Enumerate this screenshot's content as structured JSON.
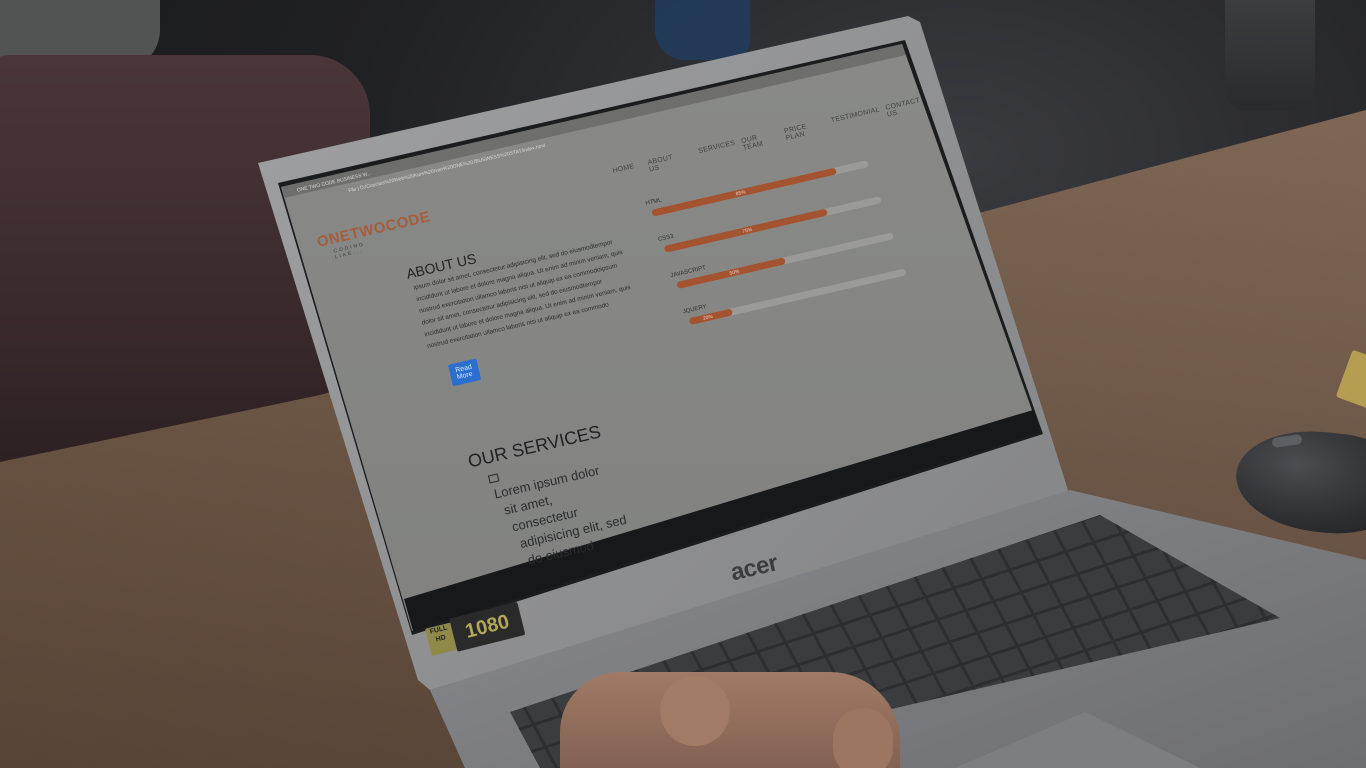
{
  "browser": {
    "tab_title": "ONE TWO CODE BUSINESS W...",
    "address": "File | D:/Courses%20Web%20Kurs%20Ivan%20ONE%20JBUSINESS%20STAT/index.html"
  },
  "site": {
    "logo": "ONETWOCODE",
    "logo_tagline": "CODING LIKE...",
    "nav": [
      "HOME",
      "ABOUT US",
      "SERVICES",
      "OUR TEAM",
      "PRICE PLAN",
      "TESTIMONIAL",
      "CONTACT US"
    ],
    "about_title": "ABOUT US",
    "about_lines": [
      "ipsum dolor sit amet, consectetur adipisicing elit, sed do eiusmodtempor",
      "incididunt ut labore et dolore magna aliqua. Ut enim ad minim veniam, quis",
      "nostrud exercitation ullamco laboris nisi ut aliquip ex ea commodoipsum",
      "dolor sit amet, consectetur adipisicing elit, sed do eiusmodtempor",
      "incididunt ut labore et dolore magna aliqua. Ut enim ad minim veniam, quis",
      "nostrud exercitation ullamco laboris nisi ut aliquip ex ea commodo"
    ],
    "read_more": "Read More",
    "skills": [
      {
        "label": "HTML",
        "pct_text": "85%",
        "value": 0.85
      },
      {
        "label": "CSS3",
        "pct_text": "75%",
        "value": 0.75
      },
      {
        "label": "JAVASCRIPT",
        "pct_text": "50%",
        "value": 0.5
      },
      {
        "label": "JQUERY",
        "pct_text": "20%",
        "value": 0.2
      }
    ],
    "services_title": "OUR SERVICES",
    "services_lines": [
      "Lorem ipsum dolor",
      "sit amet,",
      "consectetur",
      "adipisicing elit, sed",
      "do eiusmod"
    ]
  },
  "laptop": {
    "brand": "acer",
    "badge_left": "FULL HD",
    "badge_right": "1080"
  },
  "colors": {
    "accent": "#a3532f",
    "button": "#2a6ed0"
  }
}
